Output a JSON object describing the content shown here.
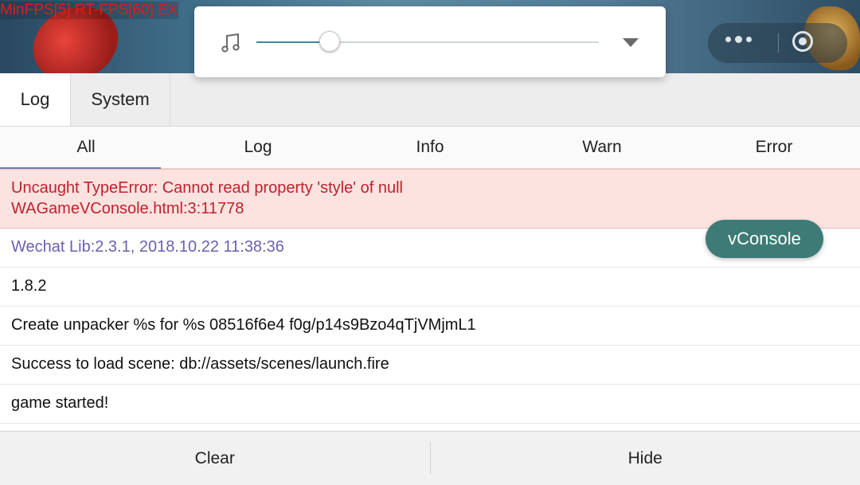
{
  "game": {
    "fps_text": "MinFPS[5] RT-FPS[60] EX"
  },
  "music_overlay": {
    "icon": "music-note-icon",
    "volume_level": 0.215,
    "dropdown_icon": "dropdown-triangle-icon"
  },
  "top_tabs": [
    {
      "label": "Log"
    },
    {
      "label": "System"
    }
  ],
  "filter_tabs": [
    {
      "label": "All"
    },
    {
      "label": "Log"
    },
    {
      "label": "Info"
    },
    {
      "label": "Warn"
    },
    {
      "label": "Error"
    }
  ],
  "logs": {
    "error_line1": "Uncaught TypeError: Cannot read property 'style' of null",
    "error_line2": "WAGameVConsole.html:3:11778",
    "info": "Wechat Lib:2.3.1, 2018.10.22 11:38:36",
    "version": "1.8.2",
    "unpacker": "Create unpacker %s for %s 08516f6e4 f0g/p14s9Bzo4qTjVMjmL1",
    "scene": "Success to load scene: db://assets/scenes/launch.fire",
    "started": "game started!"
  },
  "vconsole_button": "vConsole",
  "toolbar": {
    "clear": "Clear",
    "hide": "Hide"
  },
  "colors": {
    "error_bg": "#fce3df",
    "error_text": "#c0202f",
    "info_text": "#6b5fb0",
    "vconsole_green": "#3e7b77"
  }
}
